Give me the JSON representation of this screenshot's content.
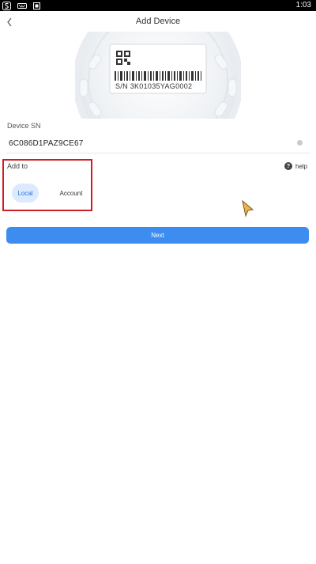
{
  "status_bar": {
    "time": "1:03",
    "icons": [
      "notification-s-icon",
      "keyboard-icon",
      "square-icon"
    ]
  },
  "header": {
    "title": "Add Device",
    "back_icon": "chevron-left-icon"
  },
  "device_image": {
    "sn_label": "S/N  3K01035YAG0002"
  },
  "device_sn": {
    "label": "Device SN",
    "value": "6C086D1PAZ9CE67"
  },
  "add_to": {
    "label": "Add to",
    "options": [
      {
        "label": "Local",
        "selected": true
      },
      {
        "label": "Account",
        "selected": false
      }
    ],
    "highlight_color": "#cc1f24"
  },
  "help": {
    "label": "help",
    "icon": "question-icon",
    "glyph": "?"
  },
  "actions": {
    "next_label": "Next",
    "next_color": "#3d8cf0"
  }
}
